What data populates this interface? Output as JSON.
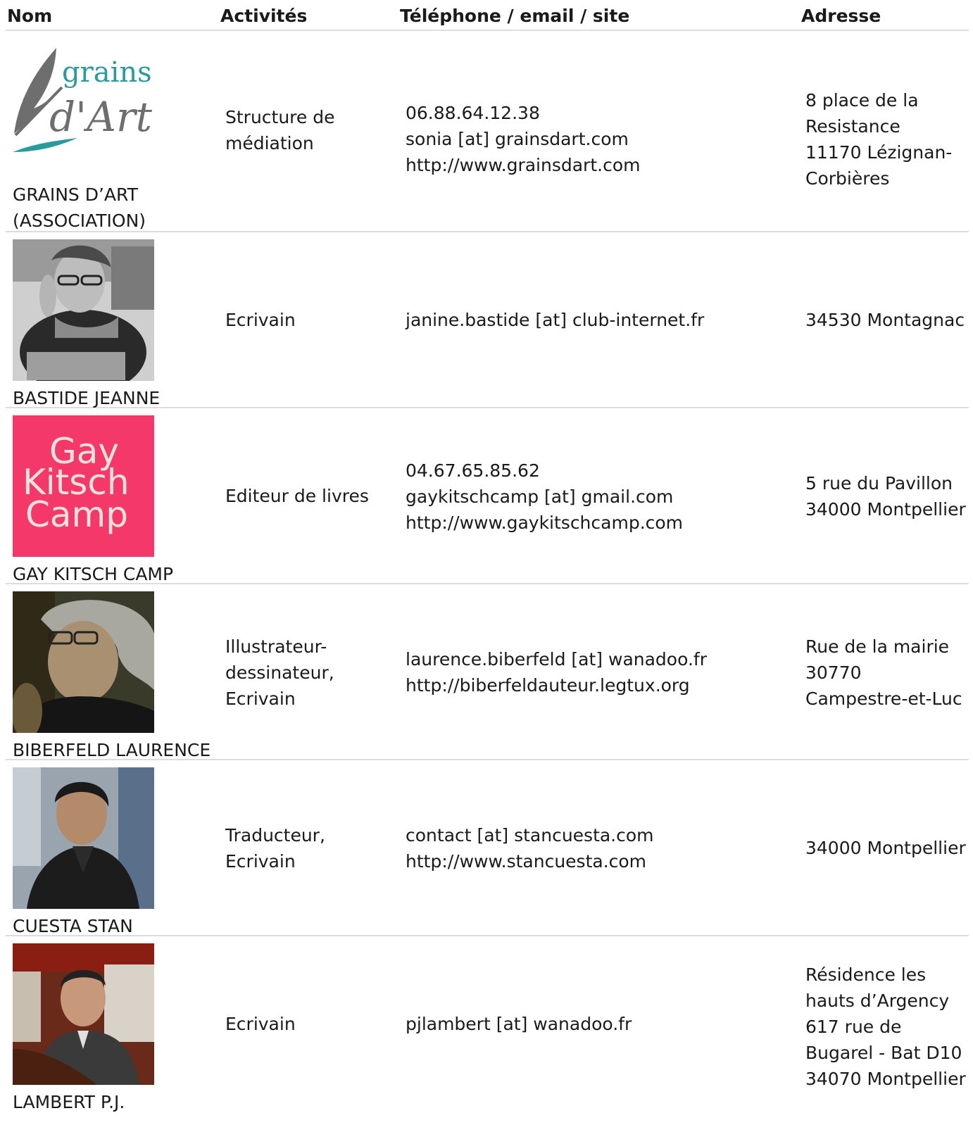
{
  "header": {
    "nom": "Nom",
    "activites": "Activités",
    "contact": "Téléphone / email / site",
    "adresse": "Adresse"
  },
  "rows": [
    {
      "name_lines": [
        "GRAINS D’ART",
        "(ASSOCIATION)"
      ],
      "activity_lines": [
        "Structure de",
        "médiation"
      ],
      "contact_lines": [
        "06.88.64.12.38",
        "sonia [at] grainsdart.com",
        "http://www.grainsdart.com"
      ],
      "address_lines": [
        "8 place de la",
        "Resistance",
        "11170 Lézignan-",
        "Corbières"
      ],
      "logo_text": [
        "grains",
        "d'Art"
      ]
    },
    {
      "name_lines": [
        "BASTIDE JEANNE"
      ],
      "activity_lines": [
        "Ecrivain"
      ],
      "contact_lines": [
        "janine.bastide [at] club-internet.fr"
      ],
      "address_lines": [
        "34530 Montagnac"
      ]
    },
    {
      "name_lines": [
        "GAY KITSCH CAMP"
      ],
      "activity_lines": [
        "Editeur de livres"
      ],
      "contact_lines": [
        "04.67.65.85.62",
        "gaykitschcamp [at] gmail.com",
        "http://www.gaykitschcamp.com"
      ],
      "address_lines": [
        "5 rue du Pavillon",
        "34000 Montpellier"
      ],
      "logo_text": [
        "Gay",
        "Kitsch",
        "Camp"
      ],
      "logo_bg": "#f5386a"
    },
    {
      "name_lines": [
        "BIBERFELD LAURENCE"
      ],
      "activity_lines": [
        "Illustrateur-",
        "dessinateur,",
        "Ecrivain"
      ],
      "contact_lines": [
        "laurence.biberfeld [at] wanadoo.fr",
        "http://biberfeldauteur.legtux.org"
      ],
      "address_lines": [
        "Rue de la mairie",
        "30770",
        "Campestre-et-Luc"
      ]
    },
    {
      "name_lines": [
        "CUESTA STAN"
      ],
      "activity_lines": [
        "Traducteur,",
        "Ecrivain"
      ],
      "contact_lines": [
        "contact [at] stancuesta.com",
        "http://www.stancuesta.com"
      ],
      "address_lines": [
        "34000 Montpellier"
      ]
    },
    {
      "name_lines": [
        "LAMBERT P.J."
      ],
      "activity_lines": [
        "Ecrivain"
      ],
      "contact_lines": [
        "pjlambert [at] wanadoo.fr"
      ],
      "address_lines": [
        "Résidence les",
        "hauts d’Argency",
        "617 rue de",
        "Bugarel - Bat D10",
        "34070 Montpellier"
      ]
    }
  ],
  "colors": {
    "divider": "#dddddd",
    "teal": "#2a9a9c",
    "gray_logo": "#6e6e6e",
    "gaykitsch_bg": "#f5386a"
  }
}
